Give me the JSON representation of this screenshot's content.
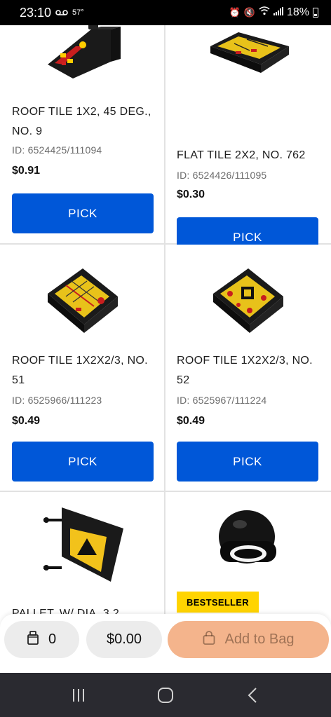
{
  "status_bar": {
    "time": "23:10",
    "voicemail_icon": "voicemail-icon",
    "temperature": "57°",
    "battery_percent": "18%"
  },
  "products": [
    {
      "name": "ROOF TILE 1X2, 45 DEG., NO. 9",
      "id": "ID: 6524425/111094",
      "price": "$0.91",
      "button": "PICK"
    },
    {
      "name": "FLAT TILE 2X2, NO. 762",
      "id": "ID: 6524426/111095",
      "price": "$0.30",
      "button": "PICK"
    },
    {
      "name": "ROOF TILE 1X2X2/3, NO. 51",
      "id": "ID: 6525966/111223",
      "price": "$0.49",
      "button": "PICK"
    },
    {
      "name": "ROOF TILE 1X2X2/3, NO. 52",
      "id": "ID: 6525967/111224",
      "price": "$0.49",
      "button": "PICK"
    },
    {
      "name": "PALLET, W/ DIA. 3.2",
      "badge": ""
    },
    {
      "name": "",
      "badge": "BESTSELLER"
    }
  ],
  "bag_bar": {
    "quantity": "0",
    "total": "$0.00",
    "add_label": "Add to Bag"
  },
  "colors": {
    "pick_button": "#0057d8",
    "add_to_bag": "#f4b48c",
    "badge": "#ffd400"
  }
}
